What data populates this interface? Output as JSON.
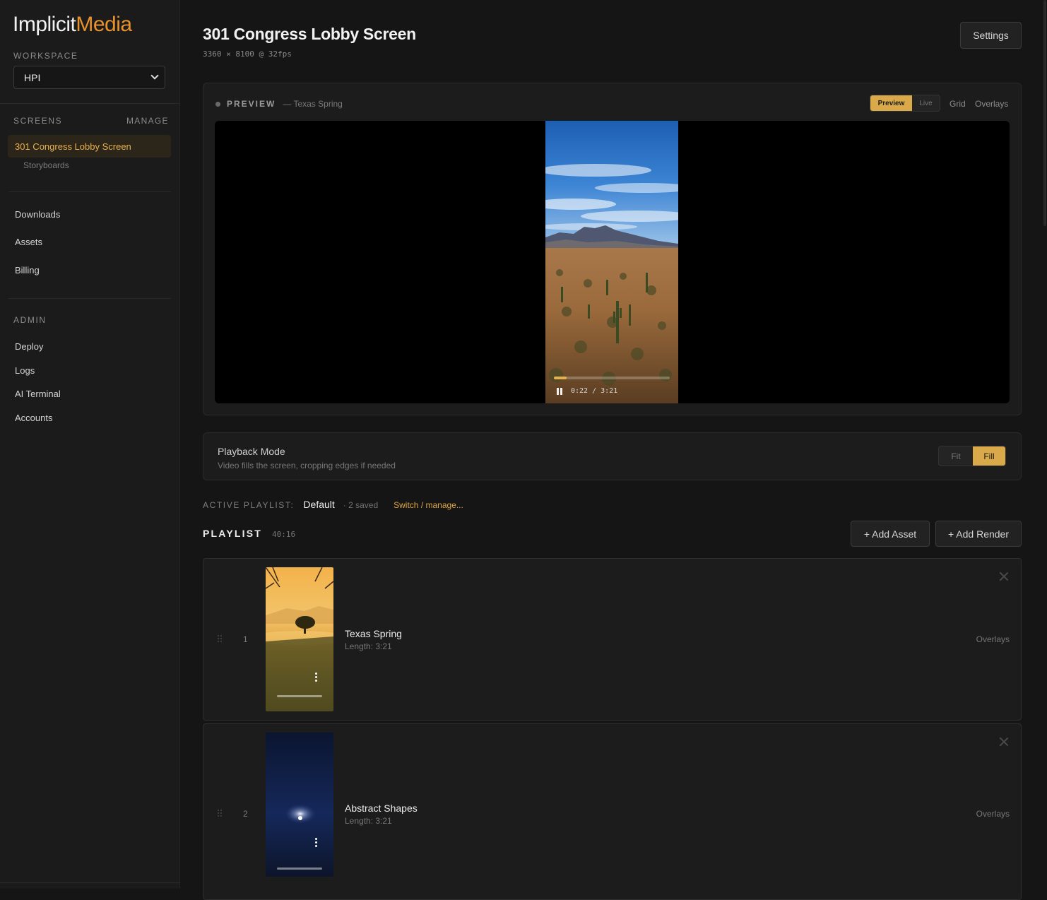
{
  "brand": {
    "part1": "Implicit",
    "part2": "Media"
  },
  "sidebar": {
    "workspace_label": "WORKSPACE",
    "workspace_value": "HPI",
    "screens_label": "SCREENS",
    "manage_label": "MANAGE",
    "active_screen": "301 Congress Lobby Screen",
    "sub_item": "Storyboards",
    "nav": [
      {
        "label": "Downloads"
      },
      {
        "label": "Assets"
      },
      {
        "label": "Billing"
      }
    ],
    "admin_label": "ADMIN",
    "admin_nav": [
      {
        "label": "Deploy"
      },
      {
        "label": "Logs"
      },
      {
        "label": "AI Terminal"
      },
      {
        "label": "Accounts"
      }
    ]
  },
  "header": {
    "title": "301 Congress Lobby Screen",
    "subtitle": "3360 × 8100 @ 32fps",
    "settings_label": "Settings"
  },
  "preview": {
    "label": "PREVIEW",
    "sub": "— Texas Spring",
    "toggle_preview": "Preview",
    "toggle_live": "Live",
    "grid_label": "Grid",
    "overlays_label": "Overlays",
    "time": "0:22 / 3:21",
    "progress": 0.11
  },
  "playback": {
    "title": "Playback Mode",
    "desc": "Video fills the screen, cropping edges if needed",
    "fit_label": "Fit",
    "fill_label": "Fill",
    "selected": "Fill"
  },
  "active_playlist": {
    "label": "ACTIVE PLAYLIST:",
    "name": "Default",
    "saved": "· 2 saved",
    "switch_label": "Switch / manage..."
  },
  "playlist": {
    "label": "PLAYLIST",
    "duration": "40:16",
    "add_asset_label": "+ Add Asset",
    "add_render_label": "+ Add Render",
    "items": [
      {
        "index": "1",
        "title": "Texas Spring",
        "length": "Length: 3:21",
        "overlays": "Overlays"
      },
      {
        "index": "2",
        "title": "Abstract Shapes",
        "length": "Length: 3:21",
        "overlays": "Overlays"
      }
    ]
  },
  "colors": {
    "accent": "#e0a642",
    "brand_orange": "#e8922e",
    "background": "#151515"
  }
}
